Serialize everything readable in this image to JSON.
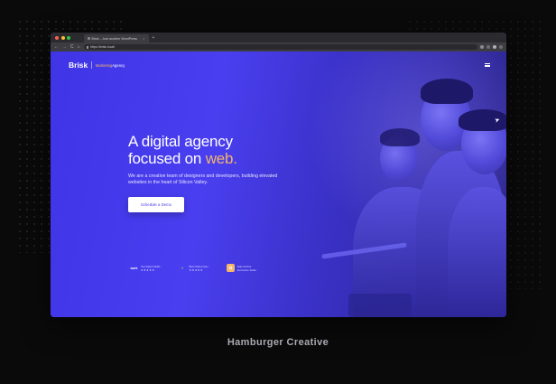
{
  "browser": {
    "tab_title": "Brisk – Just another WordPress",
    "tab_close": "×",
    "new_tab": "+",
    "nav": {
      "back": "←",
      "forward": "→",
      "reload": "C",
      "home": "⌂"
    },
    "url": "https://brisk.local/",
    "traffic_lights": [
      "#ff5f57",
      "#febc2e",
      "#28c840"
    ]
  },
  "site": {
    "logo": "Brisk",
    "tagline_accent": "Marketing",
    "tagline_rest": "Agency",
    "hero": {
      "line1": "A digital agency",
      "line2_prefix": "focused on ",
      "line2_accent": "web.",
      "subtitle": "We are a creative team of designers and developers, building elevated websites in the heart of Silicon Valley.",
      "cta_label": "Schedule a Demo"
    },
    "badges": [
      {
        "icon": "work-icon",
        "glyph": "work",
        "line1": "Top Rated Skills",
        "stars": "★★★★★"
      },
      {
        "icon": "envato-icon",
        "glyph": "✦",
        "line1": "Best Rated Item",
        "stars": "★★★★★"
      },
      {
        "icon": "elite-author-icon",
        "glyph": "✿",
        "line1": "Elite Author",
        "line2": "Exclusive Seller"
      }
    ]
  },
  "caption": "Hamburger Creative",
  "colors": {
    "accent": "#f4b66c",
    "hero_bg": "#4a3ff0",
    "cta_text": "#4a40e8"
  }
}
